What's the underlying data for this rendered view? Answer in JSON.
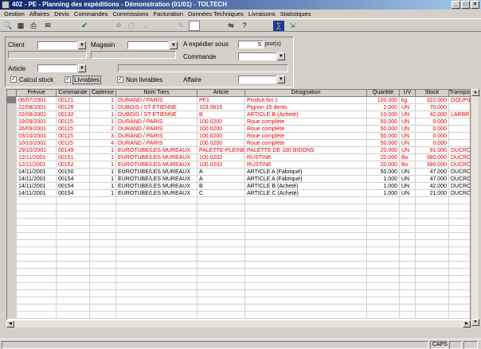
{
  "window": {
    "title": "402 - PE - Planning des expéditions - Démonstration (01/01) - TOLTECH"
  },
  "menu": [
    "Gestion",
    "Affaires",
    "Devis",
    "Commandes",
    "Commissions",
    "Facturation",
    "Données Techniques",
    "Livraisons",
    "Statistiques"
  ],
  "filters": {
    "client_label": "Client",
    "magasin_label": "Magasin",
    "a_expedier_label": "A expédier sous",
    "a_expedier_value": "5",
    "jours_label": "jour(s)",
    "commande_label": "Commande",
    "article_label": "Article",
    "affaire_label": "Affaire",
    "calcul_stock_label": "Calcul stock",
    "livrables_label": "Livrables",
    "non_livrables_label": "Non livrables"
  },
  "table": {
    "columns": [
      "Prévue",
      "Commande",
      "Cadence",
      "Nom Tiers",
      "Article",
      "Désignation",
      "Quantité",
      "UV",
      "Stock",
      "Transporteur"
    ],
    "rows": [
      {
        "red": true,
        "cells": [
          "06/07/2001",
          "00121",
          "1",
          "DURAND / PARIS",
          "PF1",
          "Produit fini 1",
          "100.000",
          "kg",
          "322.000",
          "GOUPIL"
        ]
      },
      {
        "red": true,
        "cells": [
          "22/08/2001",
          "00126",
          "1",
          "DUBOIS / ST ETIENNE",
          "103.0615",
          "Pignon 15 dents",
          "2.000",
          "UN",
          "70.000",
          ""
        ]
      },
      {
        "red": true,
        "cells": [
          "22/08/2001",
          "00132",
          "1",
          "DUBOIS / ST ETIENNE",
          "B",
          "ARTICLE B (Acheté)",
          "10.000",
          "UN",
          "42.000",
          "LARBRE"
        ]
      },
      {
        "red": true,
        "cells": [
          "19/09/2001",
          "00115",
          "1",
          "DURAND / PARIS",
          "100.0200",
          "Roue complète",
          "50.000",
          "UN",
          "0.000",
          ""
        ]
      },
      {
        "red": true,
        "cells": [
          "26/09/2001",
          "00115",
          "2",
          "DURAND / PARIS",
          "100.0200",
          "Roue complète",
          "50.000",
          "UN",
          "0.000",
          ""
        ]
      },
      {
        "red": true,
        "cells": [
          "03/10/2001",
          "00115",
          "3",
          "DURAND / PARIS",
          "100.0200",
          "Roue complète",
          "50.000",
          "UN",
          "0.000",
          ""
        ]
      },
      {
        "red": true,
        "cells": [
          "10/10/2001",
          "00115",
          "4",
          "DURAND / PARIS",
          "100.0200",
          "Roue complète",
          "50.000",
          "UN",
          "0.000",
          ""
        ]
      },
      {
        "red": true,
        "cells": [
          "29/10/2001",
          "00149",
          "1",
          "EUROTUBE/LES MUREAUX",
          "PALETTE-PLEINE",
          "PALETTE DE 180 BIDONS",
          "20.000",
          "UN",
          "91.000",
          "DUCROS"
        ]
      },
      {
        "red": true,
        "cells": [
          "12/11/2001",
          "00151",
          "1",
          "EUROTUBE/LES MUREAUX",
          "100.0202",
          "RUSTINE",
          "20.000",
          "Bo",
          "380.000",
          "DUCROS"
        ]
      },
      {
        "red": true,
        "cells": [
          "12/11/2001",
          "00152",
          "1",
          "EUROTUBE/LES MUREAUX",
          "100.0202",
          "RUSTINE",
          "20.000",
          "Bo",
          "380.000",
          "DUCROS"
        ]
      },
      {
        "red": false,
        "cells": [
          "14/11/2001",
          "00150",
          "1",
          "EUROTUBE/LES MUREAUX",
          "A",
          "ARTICLE A (Fabriqué)",
          "50.000",
          "UN",
          "47.000",
          "DUCROS"
        ]
      },
      {
        "red": false,
        "cells": [
          "14/11/2001",
          "00154",
          "1",
          "EUROTUBE/LES MUREAUX",
          "A",
          "ARTICLE A (Fabriqué)",
          "1.000",
          "UN",
          "47.000",
          "DUCROS"
        ]
      },
      {
        "red": false,
        "cells": [
          "14/11/2001",
          "00154",
          "1",
          "EUROTUBE/LES MUREAUX",
          "B",
          "ARTICLE B (Acheté)",
          "1.000",
          "UN",
          "42.000",
          "DUCROS"
        ]
      },
      {
        "red": false,
        "cells": [
          "14/11/2001",
          "00154",
          "1",
          "EUROTUBE/LES MUREAUX",
          "C",
          "ARTICLE C (Acheté)",
          "1.000",
          "UN",
          "21.000",
          "DUCROS"
        ]
      }
    ]
  },
  "status": {
    "caps": "CAPS"
  }
}
